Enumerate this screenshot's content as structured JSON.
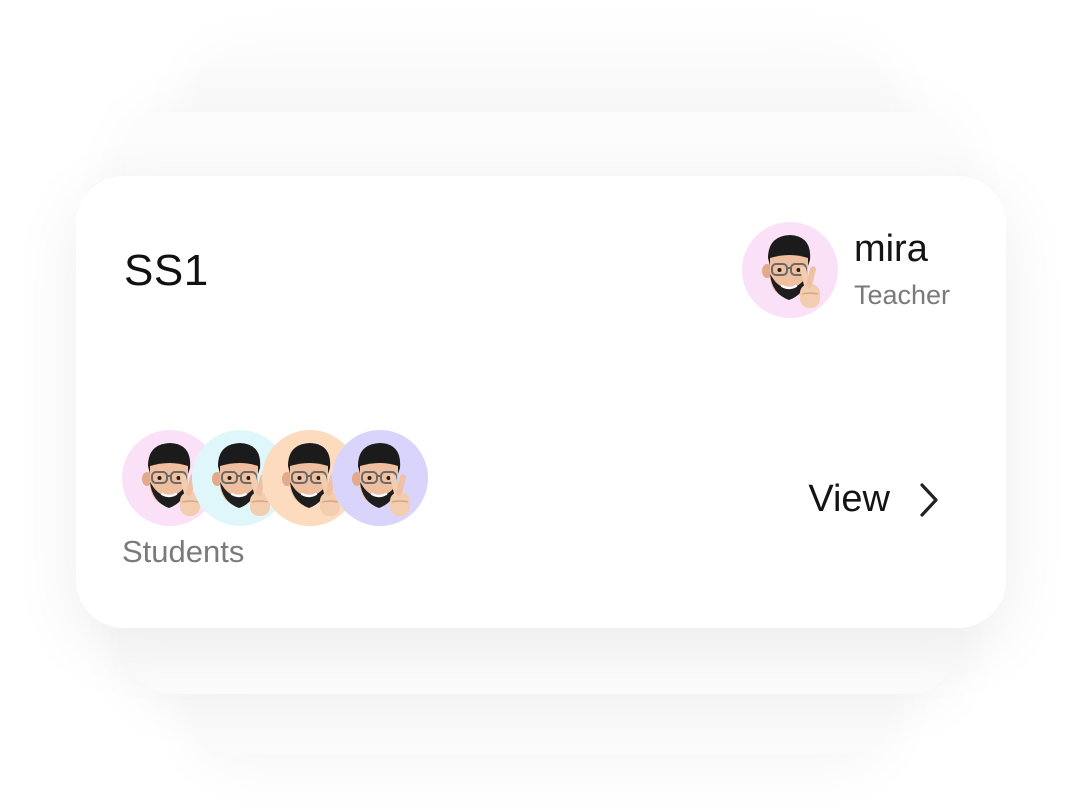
{
  "card": {
    "class_name": "SS1"
  },
  "teacher": {
    "name": "mira",
    "role": "Teacher",
    "avatar_bg": "#fbe1f7",
    "avatar_icon": "memoji-avatar-icon"
  },
  "students": {
    "label": "Students",
    "avatars": [
      {
        "bg": "#fbe1f7",
        "icon": "memoji-avatar-icon"
      },
      {
        "bg": "#dff7fb",
        "icon": "memoji-avatar-icon"
      },
      {
        "bg": "#fddbbf",
        "icon": "memoji-avatar-icon"
      },
      {
        "bg": "#d9d4fb",
        "icon": "memoji-avatar-icon"
      }
    ]
  },
  "actions": {
    "view_label": "View",
    "view_icon": "chevron-right-icon"
  }
}
